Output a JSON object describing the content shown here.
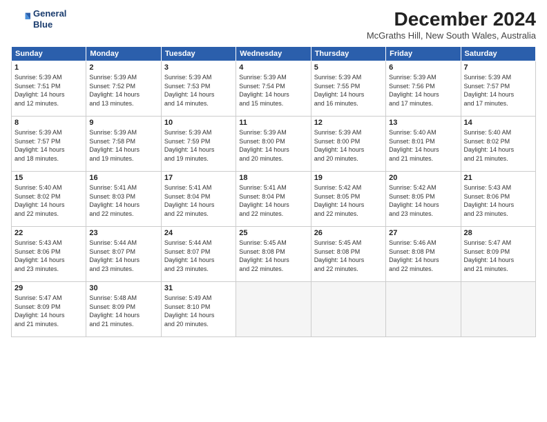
{
  "header": {
    "logo_line1": "General",
    "logo_line2": "Blue",
    "title": "December 2024",
    "location": "McGraths Hill, New South Wales, Australia"
  },
  "days_of_week": [
    "Sunday",
    "Monday",
    "Tuesday",
    "Wednesday",
    "Thursday",
    "Friday",
    "Saturday"
  ],
  "weeks": [
    [
      {
        "day": "1",
        "info": "Sunrise: 5:39 AM\nSunset: 7:51 PM\nDaylight: 14 hours\nand 12 minutes."
      },
      {
        "day": "2",
        "info": "Sunrise: 5:39 AM\nSunset: 7:52 PM\nDaylight: 14 hours\nand 13 minutes."
      },
      {
        "day": "3",
        "info": "Sunrise: 5:39 AM\nSunset: 7:53 PM\nDaylight: 14 hours\nand 14 minutes."
      },
      {
        "day": "4",
        "info": "Sunrise: 5:39 AM\nSunset: 7:54 PM\nDaylight: 14 hours\nand 15 minutes."
      },
      {
        "day": "5",
        "info": "Sunrise: 5:39 AM\nSunset: 7:55 PM\nDaylight: 14 hours\nand 16 minutes."
      },
      {
        "day": "6",
        "info": "Sunrise: 5:39 AM\nSunset: 7:56 PM\nDaylight: 14 hours\nand 17 minutes."
      },
      {
        "day": "7",
        "info": "Sunrise: 5:39 AM\nSunset: 7:57 PM\nDaylight: 14 hours\nand 17 minutes."
      }
    ],
    [
      {
        "day": "8",
        "info": "Sunrise: 5:39 AM\nSunset: 7:57 PM\nDaylight: 14 hours\nand 18 minutes."
      },
      {
        "day": "9",
        "info": "Sunrise: 5:39 AM\nSunset: 7:58 PM\nDaylight: 14 hours\nand 19 minutes."
      },
      {
        "day": "10",
        "info": "Sunrise: 5:39 AM\nSunset: 7:59 PM\nDaylight: 14 hours\nand 19 minutes."
      },
      {
        "day": "11",
        "info": "Sunrise: 5:39 AM\nSunset: 8:00 PM\nDaylight: 14 hours\nand 20 minutes."
      },
      {
        "day": "12",
        "info": "Sunrise: 5:39 AM\nSunset: 8:00 PM\nDaylight: 14 hours\nand 20 minutes."
      },
      {
        "day": "13",
        "info": "Sunrise: 5:40 AM\nSunset: 8:01 PM\nDaylight: 14 hours\nand 21 minutes."
      },
      {
        "day": "14",
        "info": "Sunrise: 5:40 AM\nSunset: 8:02 PM\nDaylight: 14 hours\nand 21 minutes."
      }
    ],
    [
      {
        "day": "15",
        "info": "Sunrise: 5:40 AM\nSunset: 8:02 PM\nDaylight: 14 hours\nand 22 minutes."
      },
      {
        "day": "16",
        "info": "Sunrise: 5:41 AM\nSunset: 8:03 PM\nDaylight: 14 hours\nand 22 minutes."
      },
      {
        "day": "17",
        "info": "Sunrise: 5:41 AM\nSunset: 8:04 PM\nDaylight: 14 hours\nand 22 minutes."
      },
      {
        "day": "18",
        "info": "Sunrise: 5:41 AM\nSunset: 8:04 PM\nDaylight: 14 hours\nand 22 minutes."
      },
      {
        "day": "19",
        "info": "Sunrise: 5:42 AM\nSunset: 8:05 PM\nDaylight: 14 hours\nand 22 minutes."
      },
      {
        "day": "20",
        "info": "Sunrise: 5:42 AM\nSunset: 8:05 PM\nDaylight: 14 hours\nand 23 minutes."
      },
      {
        "day": "21",
        "info": "Sunrise: 5:43 AM\nSunset: 8:06 PM\nDaylight: 14 hours\nand 23 minutes."
      }
    ],
    [
      {
        "day": "22",
        "info": "Sunrise: 5:43 AM\nSunset: 8:06 PM\nDaylight: 14 hours\nand 23 minutes."
      },
      {
        "day": "23",
        "info": "Sunrise: 5:44 AM\nSunset: 8:07 PM\nDaylight: 14 hours\nand 23 minutes."
      },
      {
        "day": "24",
        "info": "Sunrise: 5:44 AM\nSunset: 8:07 PM\nDaylight: 14 hours\nand 23 minutes."
      },
      {
        "day": "25",
        "info": "Sunrise: 5:45 AM\nSunset: 8:08 PM\nDaylight: 14 hours\nand 22 minutes."
      },
      {
        "day": "26",
        "info": "Sunrise: 5:45 AM\nSunset: 8:08 PM\nDaylight: 14 hours\nand 22 minutes."
      },
      {
        "day": "27",
        "info": "Sunrise: 5:46 AM\nSunset: 8:08 PM\nDaylight: 14 hours\nand 22 minutes."
      },
      {
        "day": "28",
        "info": "Sunrise: 5:47 AM\nSunset: 8:09 PM\nDaylight: 14 hours\nand 21 minutes."
      }
    ],
    [
      {
        "day": "29",
        "info": "Sunrise: 5:47 AM\nSunset: 8:09 PM\nDaylight: 14 hours\nand 21 minutes."
      },
      {
        "day": "30",
        "info": "Sunrise: 5:48 AM\nSunset: 8:09 PM\nDaylight: 14 hours\nand 21 minutes."
      },
      {
        "day": "31",
        "info": "Sunrise: 5:49 AM\nSunset: 8:10 PM\nDaylight: 14 hours\nand 20 minutes."
      },
      {
        "day": "",
        "info": ""
      },
      {
        "day": "",
        "info": ""
      },
      {
        "day": "",
        "info": ""
      },
      {
        "day": "",
        "info": ""
      }
    ]
  ]
}
